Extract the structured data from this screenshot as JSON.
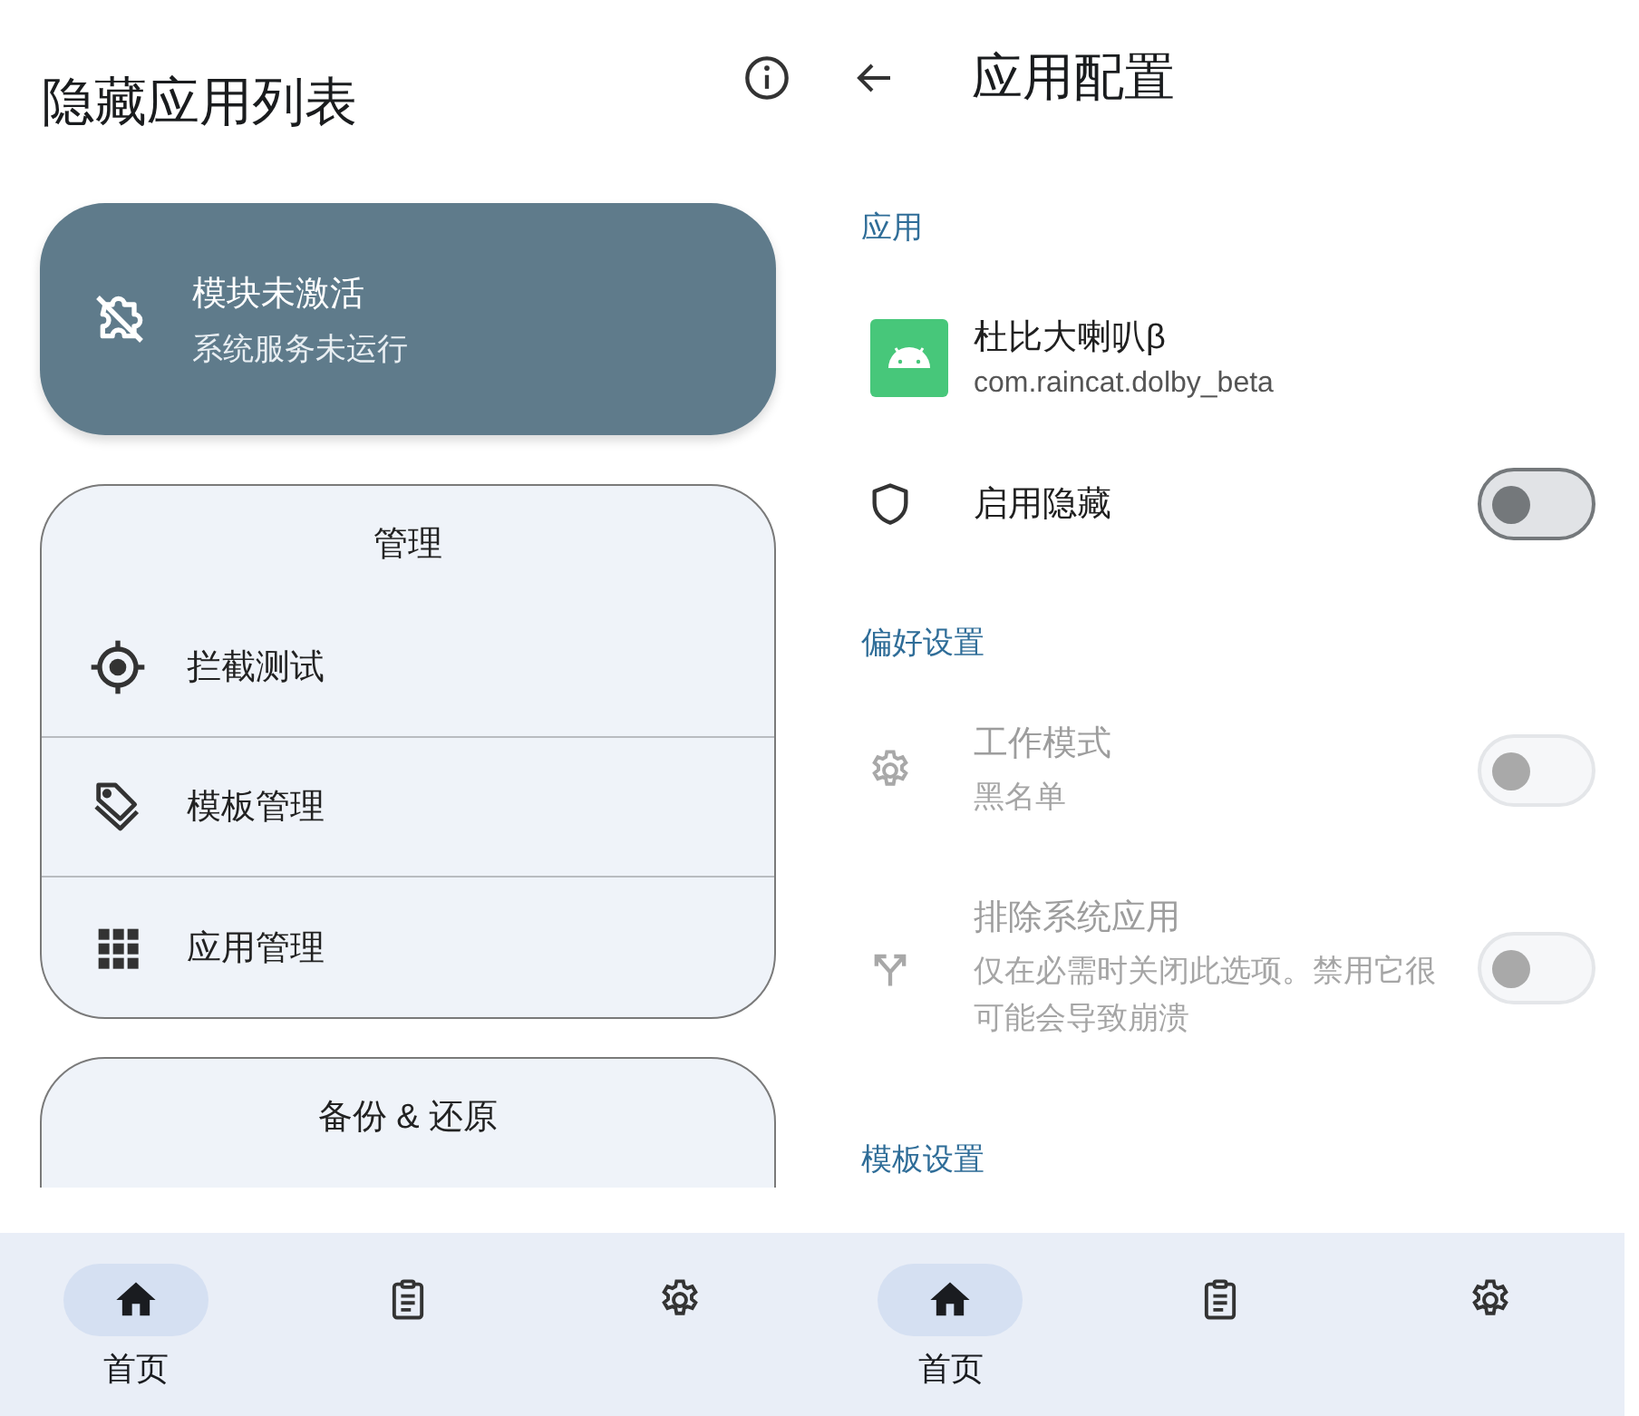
{
  "home": {
    "title": "隐藏应用列表",
    "status_card": {
      "title": "模块未激活",
      "subtitle": "系统服务未运行"
    },
    "cards": [
      {
        "title": "管理",
        "items": [
          {
            "label": "拦截测试"
          },
          {
            "label": "模板管理"
          },
          {
            "label": "应用管理"
          }
        ]
      },
      {
        "title": "备份 & 还原"
      }
    ],
    "nav": [
      {
        "label": "首页",
        "selected": true
      },
      {
        "selected": false
      },
      {
        "selected": false
      }
    ]
  },
  "app_config": {
    "title": "应用配置",
    "sections": [
      {
        "header": "应用",
        "rows": [
          {
            "kind": "app",
            "name": "杜比大喇叭β",
            "package": "com.raincat.dolby_beta"
          },
          {
            "kind": "switch",
            "title": "启用隐藏",
            "on": false,
            "disabled": false
          }
        ]
      },
      {
        "header": "偏好设置",
        "rows": [
          {
            "kind": "switch",
            "title": "工作模式",
            "summary": "黑名单",
            "on": false,
            "disabled": true
          },
          {
            "kind": "switch",
            "title": "排除系统应用",
            "summary": "仅在必需时关闭此选项。禁用它很可能会导致崩溃",
            "on": false,
            "disabled": true
          }
        ]
      },
      {
        "header": "模板设置"
      }
    ],
    "nav": [
      {
        "label": "首页",
        "selected": true
      },
      {
        "selected": false
      },
      {
        "selected": false
      }
    ]
  }
}
